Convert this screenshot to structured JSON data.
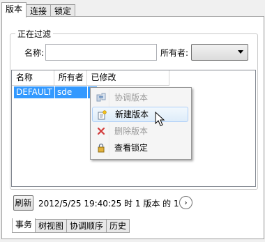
{
  "top_tabs": [
    "版本",
    "连接",
    "锁定"
  ],
  "filter": {
    "group_title": "正在过滤",
    "name_label": "名称:",
    "name_value": "",
    "owner_label": "所有者:",
    "owner_value": ""
  },
  "grid": {
    "columns": [
      "名称",
      "所有者",
      "已修改"
    ],
    "rows": [
      {
        "name": "DEFAULT",
        "owner": "sde",
        "modified": ""
      }
    ]
  },
  "context_menu": {
    "items": [
      {
        "label": "协调版本",
        "icon": "reconcile-icon",
        "enabled": false
      },
      {
        "label": "新建版本",
        "icon": "new-version-icon",
        "enabled": true,
        "hovered": true
      },
      {
        "label": "删除版本",
        "icon": "delete-icon",
        "enabled": false
      },
      {
        "label": "查看锁定",
        "icon": "lock-icon",
        "enabled": true
      }
    ]
  },
  "footer": {
    "refresh_label": "刷新",
    "status_text": "2012/5/25 19:40:25 时 1 版本 的 1",
    "nav_glyph": "›"
  },
  "bottom_tabs": [
    "事务",
    "树视图",
    "协调顺序",
    "历史"
  ],
  "colors": {
    "selection": "#3399ff",
    "menu_hover_border": "#aecff7"
  }
}
